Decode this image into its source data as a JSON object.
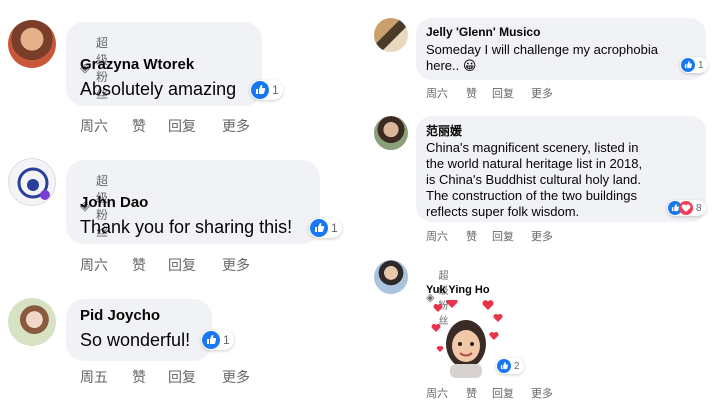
{
  "comments": [
    {
      "badge": "超级粉丝",
      "author": "Grazyna Wtorek",
      "text": "Absolutely amazing",
      "reactions": "1",
      "actions": {
        "time": "周六",
        "like": "赞",
        "reply": "回复",
        "more": "更多"
      }
    },
    {
      "badge": "超级粉丝",
      "author": "John Dao",
      "text": "Thank you for sharing this!",
      "reactions": "1",
      "actions": {
        "time": "周六",
        "like": "赞",
        "reply": "回复",
        "more": "更多"
      }
    },
    {
      "author": "Pid Joycho",
      "text": "So wonderful!",
      "reactions": "1",
      "actions": {
        "time": "周五",
        "like": "赞",
        "reply": "回复",
        "more": "更多"
      }
    },
    {
      "author": "Jelly 'Glenn' Musico",
      "text_lines": [
        "Someday I will challenge my acrophobia",
        "here.. 😀"
      ],
      "reactions": "1",
      "actions": {
        "time": "周六",
        "like": "赞",
        "reply": "回复",
        "more": "更多"
      }
    },
    {
      "author": "范丽媛",
      "text_lines": [
        "China's magnificent scenery, listed in",
        "the world natural heritage list in 2018,",
        "is China's Buddhist cultural holy land.",
        "The construction of the two buildings",
        "reflects super folk wisdom."
      ],
      "reactions": "8",
      "actions": {
        "time": "周六",
        "like": "赞",
        "reply": "回复",
        "more": "更多"
      }
    },
    {
      "badge": "超级粉丝",
      "author": "Yuk Ying Ho",
      "reactions": "2",
      "actions": {
        "time": "周六",
        "like": "赞",
        "reply": "回复",
        "more": "更多"
      }
    }
  ],
  "colors": {
    "bubble": "#f0f2f5",
    "like": "#1877f2",
    "love": "#f33e58",
    "secondary": "#65676b"
  }
}
